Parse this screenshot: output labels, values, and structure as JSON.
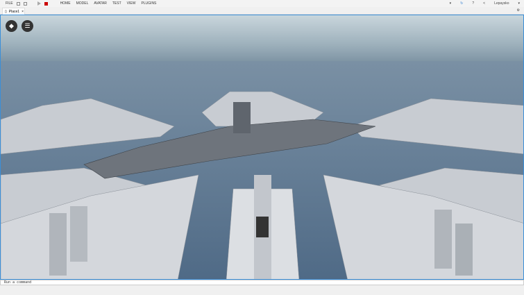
{
  "menu": {
    "file": "FILE",
    "items": [
      "HOME",
      "MODEL",
      "AVATAR",
      "TEST",
      "VIEW",
      "PLUGINS"
    ],
    "username": "Lepaysko"
  },
  "tab": {
    "label": "Place1",
    "close": "×"
  },
  "command": {
    "placeholder": "Run a command"
  },
  "colors": {
    "accent": "#3a8fd9",
    "stop": "#cc0000"
  }
}
